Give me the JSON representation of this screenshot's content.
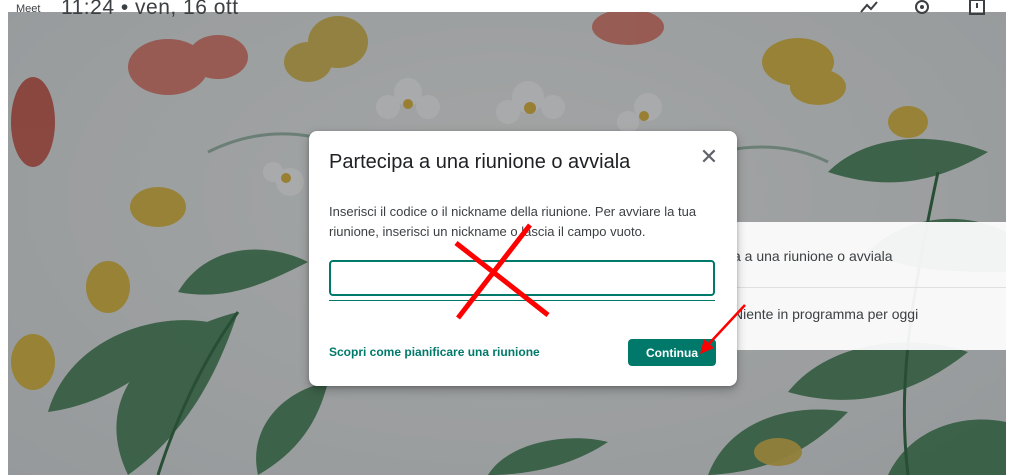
{
  "topbar": {
    "app_name": "Meet",
    "datetime": "11:24  •  ven, 16 ott",
    "icons": [
      "feedback-icon",
      "settings-gear-icon",
      "account-icon"
    ]
  },
  "side_card": {
    "join_text": "a a una riunione o avviala",
    "agenda_text": "Niente in programma per oggi"
  },
  "dialog": {
    "title": "Partecipa a una riunione o avviala",
    "close_symbol": "✕",
    "description": "Inserisci il codice o il nickname della riunione. Per avviare la tua riunione, inserisci un nickname o lascia il campo vuoto.",
    "input_value": "",
    "learn_link": "Scopri come pianificare una riunione",
    "continue_label": "Continua"
  },
  "colors": {
    "accent": "#00796b",
    "annotation": "#ff0000"
  }
}
